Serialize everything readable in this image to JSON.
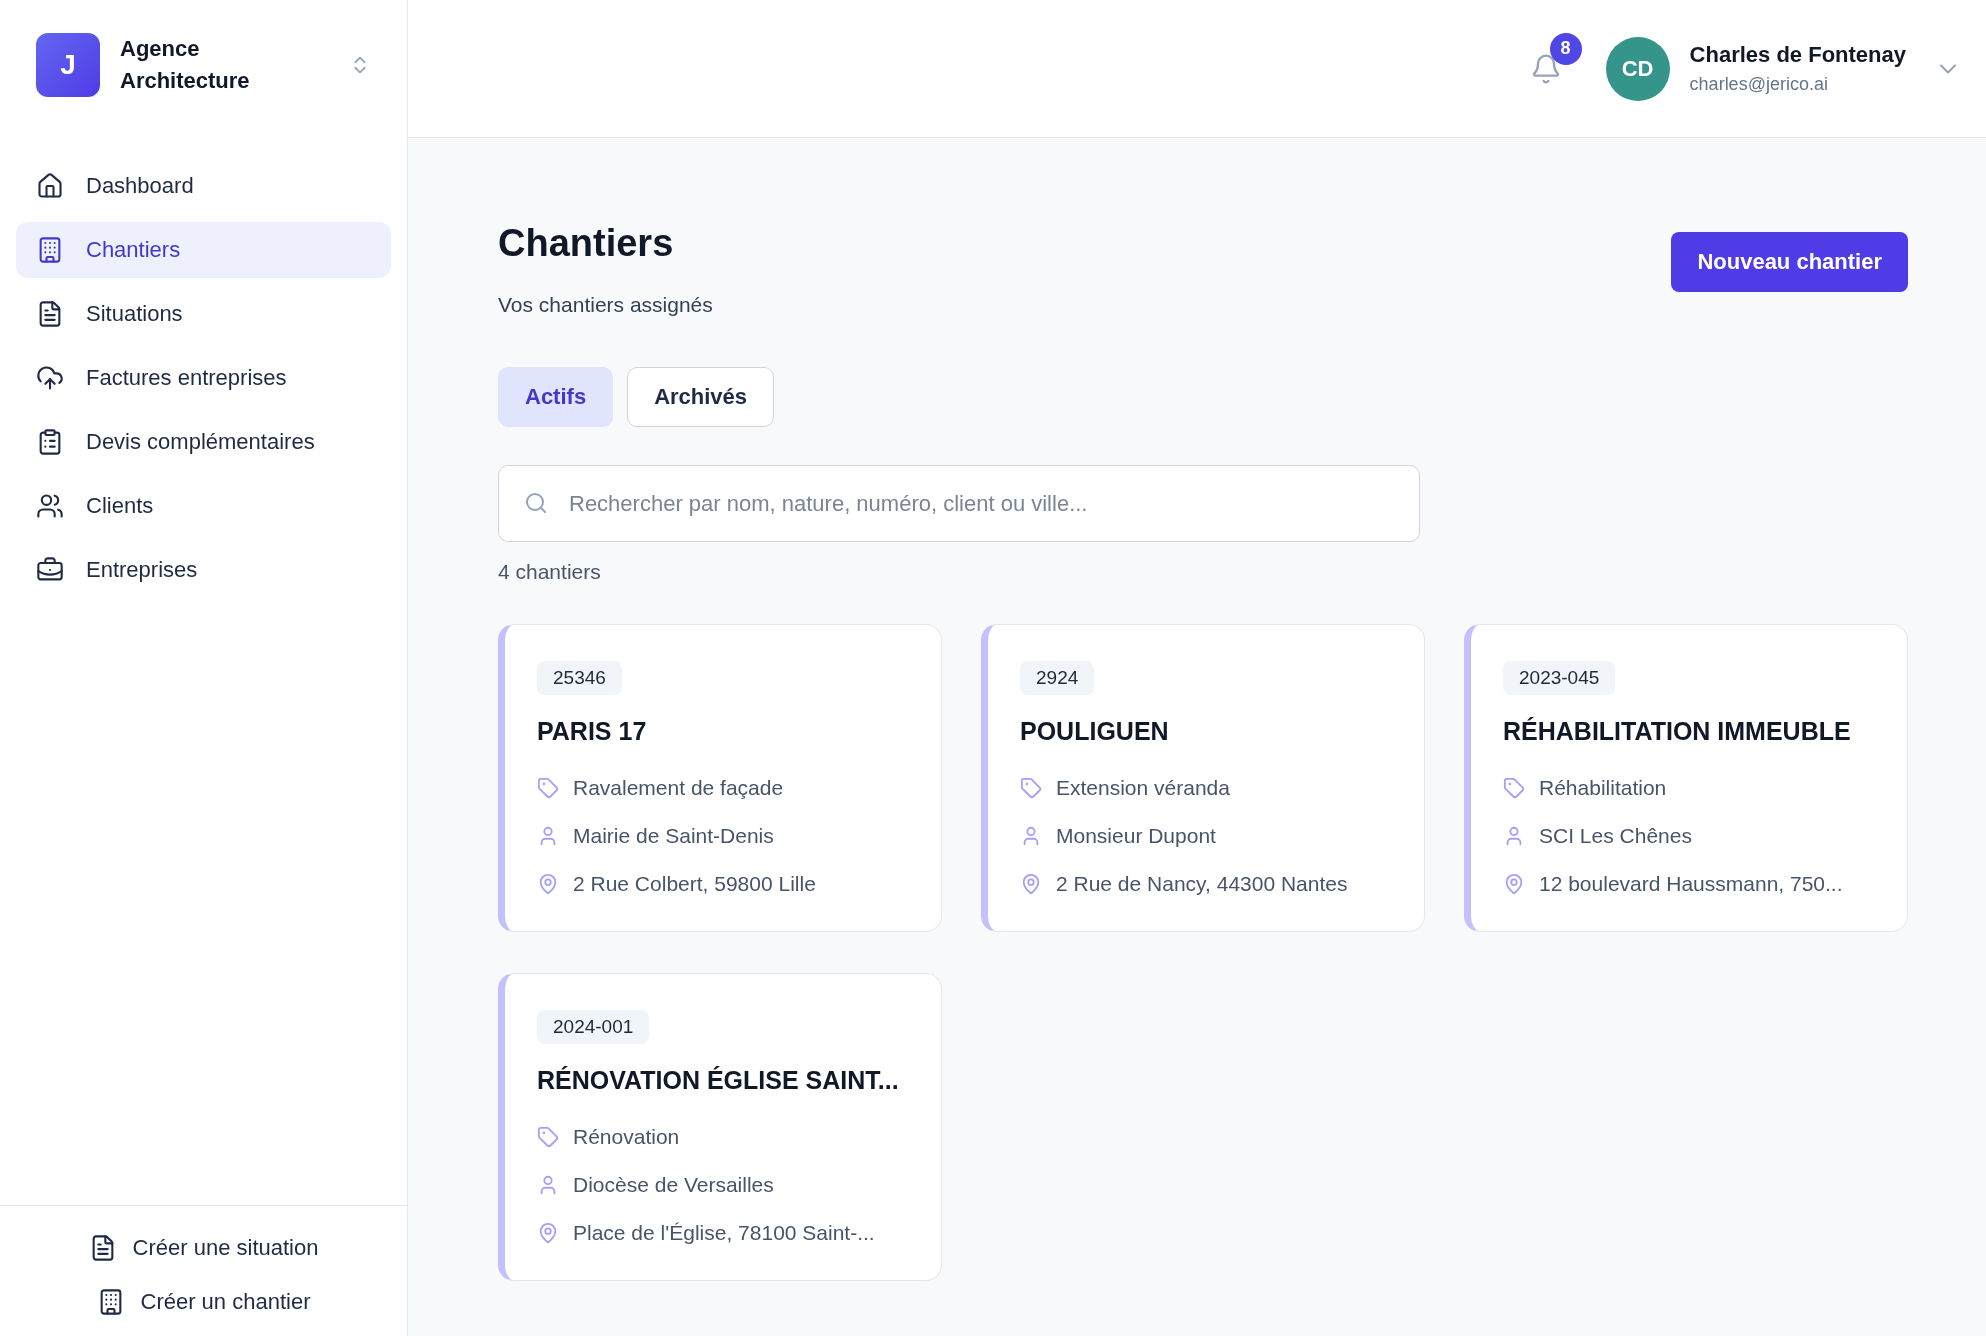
{
  "workspace": {
    "logo_letter": "J",
    "name": "Agence Architecture"
  },
  "sidebar": {
    "items": [
      {
        "label": "Dashboard",
        "selected": false
      },
      {
        "label": "Chantiers",
        "selected": true
      },
      {
        "label": "Situations",
        "selected": false
      },
      {
        "label": "Factures entreprises",
        "selected": false
      },
      {
        "label": "Devis complémentaires",
        "selected": false
      },
      {
        "label": "Clients",
        "selected": false
      },
      {
        "label": "Entreprises",
        "selected": false
      }
    ],
    "actions": [
      {
        "label": "Créer une situation"
      },
      {
        "label": "Créer un chantier"
      }
    ]
  },
  "header": {
    "notifications": "8",
    "user": {
      "initials": "CD",
      "name": "Charles de Fontenay",
      "email": "charles@jerico.ai"
    }
  },
  "page": {
    "title": "Chantiers",
    "subtitle": "Vos chantiers assignés",
    "new_button": "Nouveau chantier",
    "tabs": [
      {
        "label": "Actifs",
        "selected": true
      },
      {
        "label": "Archivés",
        "selected": false
      }
    ],
    "search": {
      "placeholder": "Rechercher par nom, nature, numéro, client ou ville..."
    },
    "count": "4 chantiers",
    "cards": [
      {
        "number": "25346",
        "title": "PARIS 17",
        "nature": "Ravalement de façade",
        "client": "Mairie de Saint-Denis",
        "address": "2 Rue Colbert, 59800 Lille"
      },
      {
        "number": "2924",
        "title": "POULIGUEN",
        "nature": "Extension véranda",
        "client": "Monsieur Dupont",
        "address": "2 Rue de Nancy, 44300 Nantes"
      },
      {
        "number": "2023-045",
        "title": "RÉHABILITATION IMMEUBLE",
        "nature": "Réhabilitation",
        "client": "SCI Les Chênes",
        "address": "12 boulevard Haussmann, 750..."
      },
      {
        "number": "2024-001",
        "title": "RÉNOVATION ÉGLISE SAINT...",
        "nature": "Rénovation",
        "client": "Diocèse de Versailles",
        "address": "Place de l'Église, 78100 Saint-..."
      }
    ]
  }
}
